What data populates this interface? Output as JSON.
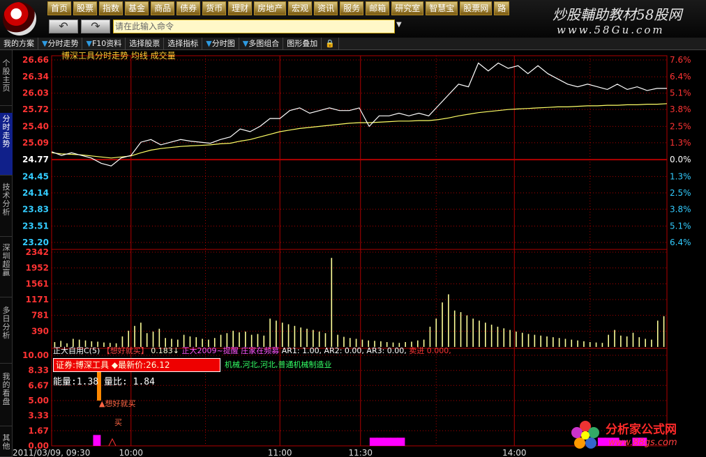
{
  "app": {
    "command_placeholder": "请在此输入命令",
    "brand": "炒股輔助教材58股网",
    "brand_url": "www.58Gu.com"
  },
  "menu": [
    "首页",
    "股票",
    "指数",
    "基金",
    "商品",
    "债券",
    "货币",
    "理财",
    "房地产",
    "宏观",
    "资讯",
    "服务",
    "邮箱",
    "研究室",
    "智慧宝",
    "股票网",
    "路"
  ],
  "toolbar": [
    "我的方案",
    "分时走势",
    "F10资料",
    "选择股票",
    "选择指标",
    "分时图",
    "多图组合",
    "图形叠加"
  ],
  "side_tabs": [
    "个股主页",
    "分时走势",
    "技术分析",
    "深圳超赢",
    "多日分析",
    "我的看盘",
    "其他"
  ],
  "chart_header": "博深工具分时走势  均线  成交量",
  "indicator_header": {
    "name": "正大自用C(5)",
    "buy_tag": "【想好就买】",
    "v1": "0.183↓",
    "alert": "正大2009~提醒",
    "hold": "庄家在频募",
    "ar1": "AR1: 1.00,",
    "ar2": "AR2: 0.00,",
    "ar3": "AR3: 0.00,",
    "sell": "卖进  0.000,"
  },
  "info": {
    "label": "证券:博深工具",
    "price_label": "◆最新价:26.12",
    "industry": "机械,河北,河北,普通机械制造业",
    "energy": "能量:1.38  量比: 1.84"
  },
  "annotations": {
    "buy": "▲想好就买",
    "buy2": "买"
  },
  "date_label": "2011/03/09, 09:30",
  "watermark": {
    "name": "分析家公式网",
    "url": "www.88gs.com"
  },
  "colors": {
    "grid": "#b00000",
    "price": "#ffffff",
    "avg": "#ffff66",
    "volume": "#ffff99",
    "up": "#ff3333",
    "down": "#33ccff",
    "indicator": "#ff00ff"
  },
  "chart_data": {
    "type": "line",
    "x_ticks": [
      "10:00",
      "11:00",
      "11:30",
      "14:00"
    ],
    "y_price_ticks": [
      26.66,
      26.34,
      26.03,
      25.72,
      25.4,
      25.09,
      24.77,
      24.45,
      24.14,
      23.83,
      23.51,
      23.2
    ],
    "y_pct_ticks": [
      "7.6%",
      "6.4%",
      "5.1%",
      "3.8%",
      "2.5%",
      "1.3%",
      "0.0%",
      "1.3%",
      "2.5%",
      "3.8%",
      "5.1%",
      "6.4%"
    ],
    "y_volume_ticks": [
      2342,
      1952,
      1561,
      1171,
      781,
      390
    ],
    "y_indicator_ticks": [
      "10.00",
      "8.33",
      "6.67",
      "5.00",
      "3.33",
      "1.67",
      "0.00"
    ],
    "prev_close": 24.77,
    "price": [
      24.92,
      24.85,
      24.9,
      24.85,
      24.8,
      24.7,
      24.65,
      24.8,
      24.85,
      25.1,
      25.15,
      25.05,
      25.1,
      25.15,
      25.12,
      25.1,
      25.08,
      25.15,
      25.2,
      25.35,
      25.3,
      25.4,
      25.55,
      25.55,
      25.7,
      25.75,
      25.65,
      25.7,
      25.75,
      25.7,
      25.7,
      25.75,
      25.4,
      25.6,
      25.6,
      25.65,
      25.6,
      25.65,
      25.6,
      25.8,
      26.0,
      26.2,
      26.15,
      26.6,
      26.45,
      26.6,
      26.5,
      26.55,
      26.4,
      26.55,
      26.4,
      26.3,
      26.2,
      26.15,
      26.2,
      26.15,
      26.1,
      26.2,
      26.1,
      26.15,
      26.08,
      26.12,
      26.12
    ],
    "avg": [
      24.9,
      24.88,
      24.87,
      24.86,
      24.84,
      24.82,
      24.8,
      24.82,
      24.84,
      24.9,
      24.95,
      24.98,
      25.0,
      25.02,
      25.03,
      25.04,
      25.05,
      25.07,
      25.08,
      25.12,
      25.15,
      25.2,
      25.25,
      25.3,
      25.33,
      25.36,
      25.38,
      25.4,
      25.42,
      25.44,
      25.46,
      25.47,
      25.47,
      25.48,
      25.49,
      25.5,
      25.5,
      25.51,
      25.51,
      25.53,
      25.56,
      25.6,
      25.63,
      25.66,
      25.68,
      25.7,
      25.72,
      25.73,
      25.74,
      25.75,
      25.76,
      25.77,
      25.77,
      25.78,
      25.79,
      25.79,
      25.8,
      25.8,
      25.81,
      25.81,
      25.82,
      25.82,
      25.83
    ],
    "volume": [
      120,
      150,
      90,
      200,
      180,
      160,
      140,
      130,
      110,
      100,
      90,
      260,
      400,
      520,
      600,
      340,
      380,
      450,
      220,
      200,
      180,
      300,
      260,
      240,
      200,
      180,
      220,
      300,
      340,
      400,
      360,
      380,
      300,
      320,
      280,
      700,
      650,
      600,
      560,
      520,
      480,
      450,
      420,
      380,
      340,
      2200,
      300,
      250,
      220,
      200,
      180,
      160,
      150,
      140,
      120,
      110,
      100,
      120,
      130,
      160,
      180,
      500,
      700,
      1100,
      1300,
      900,
      860,
      780,
      700,
      650,
      600,
      550,
      500,
      460,
      420,
      380,
      350,
      320,
      300,
      280,
      260,
      240,
      220,
      200,
      180,
      160,
      140,
      120,
      110,
      100,
      300,
      420,
      280,
      260,
      350,
      240,
      200,
      180,
      650,
      760
    ],
    "indicator": [
      0,
      0,
      0,
      0,
      0,
      0,
      1.2,
      0,
      0,
      0,
      0,
      0,
      0,
      0,
      0,
      0,
      0,
      0,
      0,
      0,
      0,
      0,
      0,
      0,
      0,
      0,
      0,
      0,
      0,
      0,
      0,
      0,
      0,
      0,
      0,
      0,
      0,
      0,
      0,
      0,
      0,
      0,
      0,
      0,
      0,
      0,
      0.9,
      0.9,
      0.9,
      0.9,
      0.9,
      0,
      0,
      0,
      0,
      0,
      0,
      0,
      0,
      0,
      0,
      0,
      0,
      0,
      0,
      0,
      0,
      0,
      0,
      0,
      0,
      0,
      0,
      0,
      0,
      0,
      0,
      0,
      0,
      0.9,
      0.9,
      0.9,
      0.6,
      0,
      0.9,
      0.9,
      0,
      0,
      0
    ]
  }
}
